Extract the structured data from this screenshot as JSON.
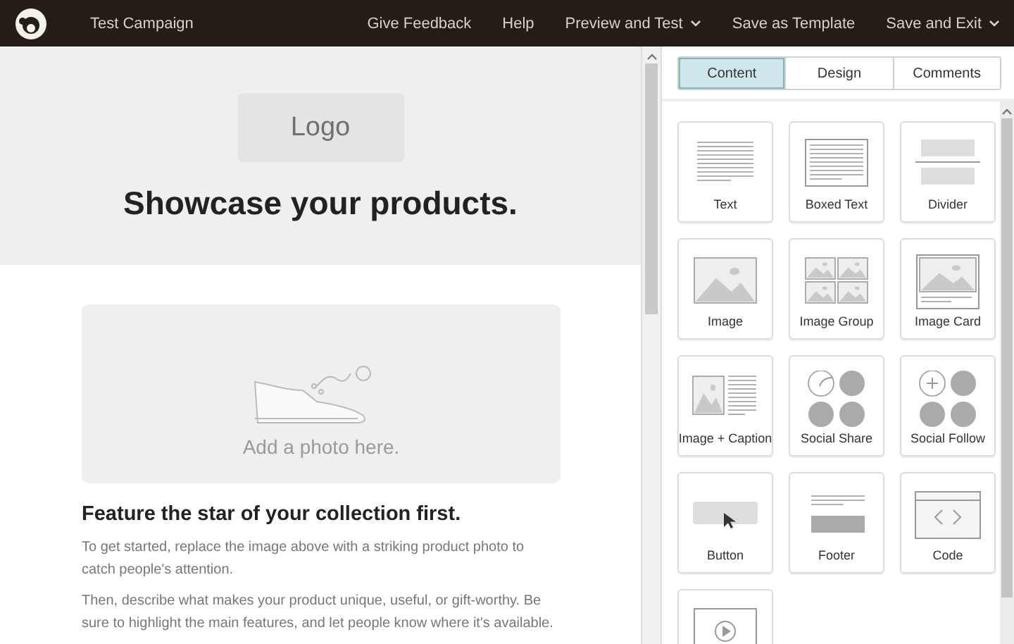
{
  "topbar": {
    "campaign": "Test Campaign",
    "actions": [
      {
        "label": "Give Feedback",
        "dropdown": false
      },
      {
        "label": "Help",
        "dropdown": false
      },
      {
        "label": "Preview and Test",
        "dropdown": true
      },
      {
        "label": "Save as Template",
        "dropdown": false
      },
      {
        "label": "Save and Exit",
        "dropdown": true
      }
    ]
  },
  "email": {
    "logo": "Logo",
    "headline": "Showcase your products.",
    "photo_placeholder": "Add a photo here.",
    "heading": "Feature the star of your collection first.",
    "paragraphs": [
      "To get started, replace the image above with a striking product photo to catch people's attention.",
      "Then, describe what makes your product unique, useful, or gift-worthy. Be sure to highlight the main features, and let people know where it's available."
    ]
  },
  "tabs": [
    {
      "label": "Content",
      "selected": true
    },
    {
      "label": "Design",
      "selected": false
    },
    {
      "label": "Comments",
      "selected": false
    }
  ],
  "blocks": [
    {
      "kind": "text",
      "label": "Text"
    },
    {
      "kind": "boxed-text",
      "label": "Boxed Text"
    },
    {
      "kind": "divider",
      "label": "Divider"
    },
    {
      "kind": "image",
      "label": "Image"
    },
    {
      "kind": "image-group",
      "label": "Image Group"
    },
    {
      "kind": "image-card",
      "label": "Image Card"
    },
    {
      "kind": "image-caption",
      "label": "Image + Caption"
    },
    {
      "kind": "social-share",
      "label": "Social Share"
    },
    {
      "kind": "social-follow",
      "label": "Social Follow"
    },
    {
      "kind": "button",
      "label": "Button"
    },
    {
      "kind": "footer",
      "label": "Footer"
    },
    {
      "kind": "code",
      "label": "Code"
    },
    {
      "kind": "video"
    }
  ]
}
